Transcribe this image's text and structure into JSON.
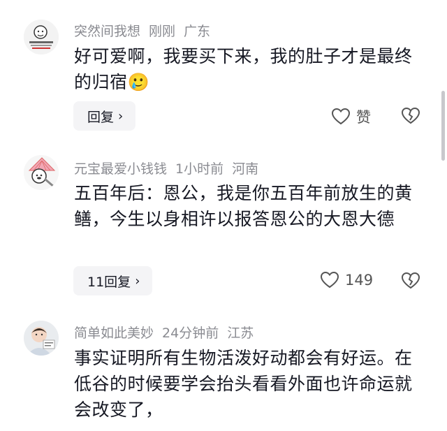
{
  "comments": [
    {
      "user": "突然间我想",
      "time": "刚刚",
      "location": "广东",
      "text": "好可爱啊，我要买下来，我的肚子才是最终的归宿🥲",
      "reply_label": "回复",
      "like_label": "赞",
      "avatar_icon": "sticker-avatar-icon"
    },
    {
      "user": "元宝最爱小钱钱",
      "time": "1小时前",
      "location": "河南",
      "text": "五百年后：恩公，我是你五百年前放生的黄鳝，今生以身相许以报答恩公的大恩大德",
      "reply_label": "11回复",
      "like_label": "149",
      "avatar_icon": "cartoon-fan-avatar-icon"
    },
    {
      "user": "简单如此美妙",
      "time": "24分钟前",
      "location": "江苏",
      "text": "事实证明所有生物活泼好动都会有好运。在低谷的时候要学会抬头看看外面也许命运就会改变了，",
      "avatar_icon": "child-photo-avatar-icon"
    }
  ],
  "colors": {
    "text": "#161823",
    "meta": "#8a8b91",
    "button_bg": "#f4f4f6"
  }
}
